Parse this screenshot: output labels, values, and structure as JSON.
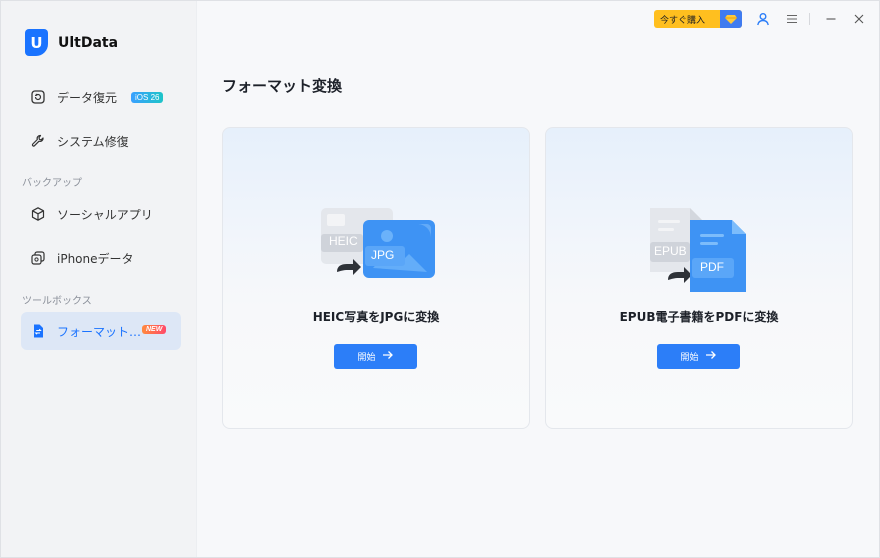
{
  "app": {
    "name": "UltData",
    "logo_letter": "U"
  },
  "sidebar": {
    "items": [
      {
        "label": "データ復元",
        "icon": "restore-icon",
        "badge": "iOS 26"
      },
      {
        "label": "システム修復",
        "icon": "wrench-icon"
      },
      {
        "label": "ソーシャルアプリ",
        "icon": "cube-icon"
      },
      {
        "label": "iPhoneデータ",
        "icon": "copy-icon"
      },
      {
        "label": "フォーマット…",
        "icon": "convert-file-icon",
        "badge": "NEW",
        "active": true
      }
    ],
    "sections": {
      "backup": "バックアップ",
      "toolbox": "ツールボックス"
    }
  },
  "topbar": {
    "buy_label": "今すぐ購入"
  },
  "main": {
    "title": "フォーマット変換",
    "cards": [
      {
        "title": "HEIC写真をJPGに変換",
        "button": "開始",
        "from": "HEIC",
        "to": "JPG"
      },
      {
        "title": "EPUB電子書籍をPDFに変換",
        "button": "開始",
        "from": "EPUB",
        "to": "PDF"
      }
    ]
  },
  "colors": {
    "accent": "#2c7ef8",
    "buy": "#ffbf1f",
    "active_bg": "#dde7f6"
  }
}
